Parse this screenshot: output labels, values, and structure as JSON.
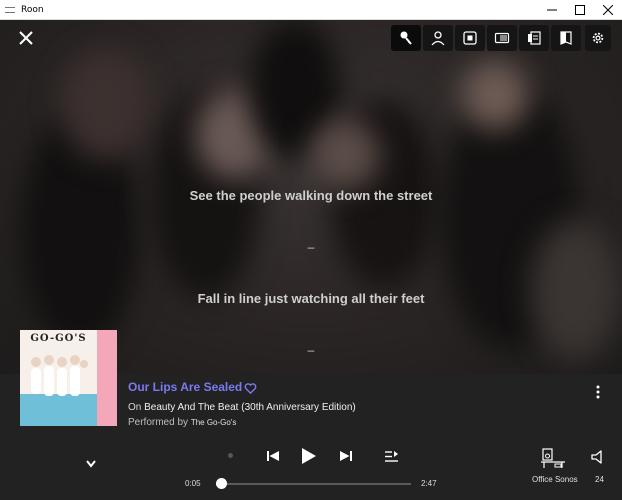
{
  "window": {
    "title": "Roon"
  },
  "toolbar": {
    "buttons": [
      {
        "icon": "lyrics-icon",
        "active": true
      },
      {
        "icon": "person-icon"
      },
      {
        "icon": "focus-icon"
      },
      {
        "icon": "credits-icon"
      },
      {
        "icon": "album-info-icon"
      },
      {
        "icon": "book-icon"
      }
    ],
    "settings_icon": "gear-icon"
  },
  "lyrics": {
    "line1": "See the people walking down the street",
    "sep1": "–",
    "line2": "Fall in line just watching all their feet",
    "sep2": "–"
  },
  "album_art": {
    "logo": "GO-GO'S"
  },
  "now_playing": {
    "title": "Our Lips Are Sealed",
    "on_prefix": "On",
    "album": "Beauty And The Beat (30th Anniversary Edition)",
    "performed_prefix": "Performed by",
    "artist": "The Go-Go's"
  },
  "playback": {
    "elapsed": "0:05",
    "duration": "2:47",
    "progress_fraction": 0.03
  },
  "zone": {
    "name": "Office Sonos"
  },
  "volume": {
    "value": "24"
  },
  "colors": {
    "accent": "#7b79f0",
    "panel": "#222222"
  }
}
